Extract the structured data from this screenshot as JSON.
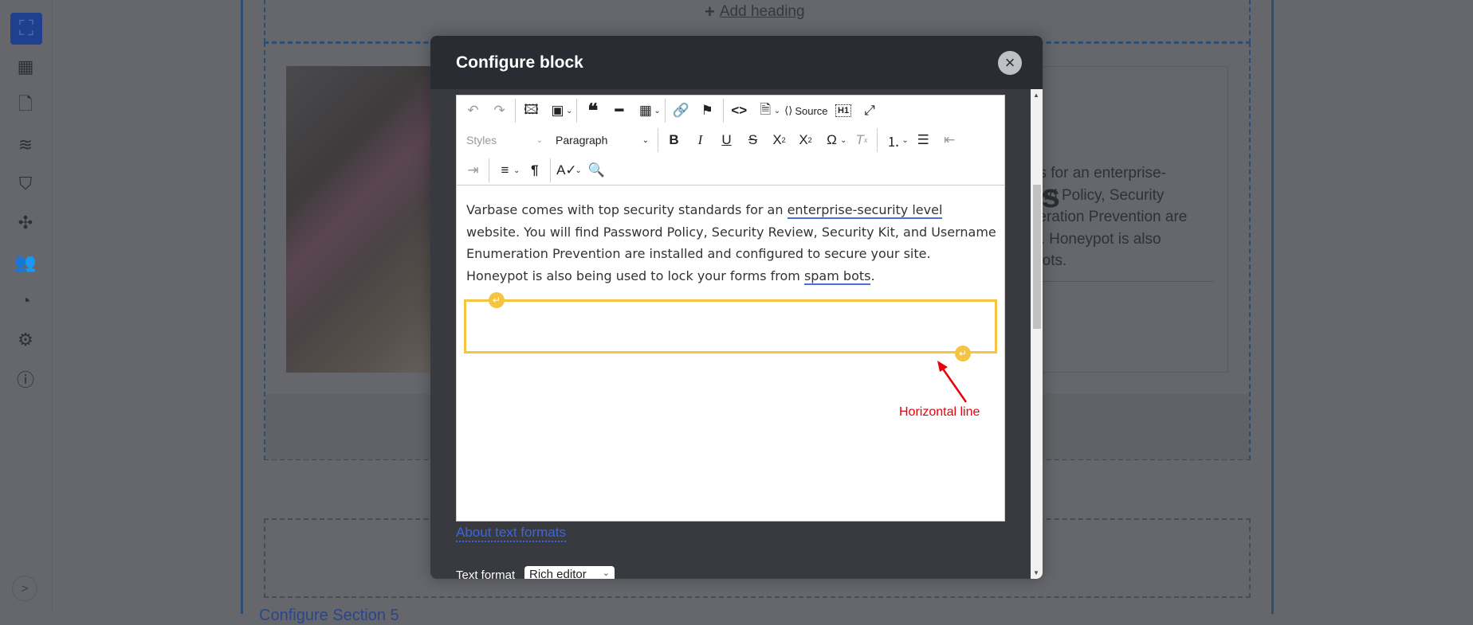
{
  "sidebar": {
    "icons": [
      "frame-icon",
      "dashboard-icon",
      "file-icon",
      "layers-icon",
      "paint-icon",
      "puzzle-icon",
      "users-icon",
      "pie-chart-icon",
      "gear-icon",
      "help-icon"
    ],
    "expand_label": ">"
  },
  "canvas": {
    "add_heading": "Add heading",
    "card_heading": "ds",
    "card_text": [
      "ards for an enterprise-",
      "sword Policy, Security",
      "umeration Prevention are",
      "site. Honeypot is also",
      "m bots."
    ],
    "bottom_link": "Configure Section 5"
  },
  "modal": {
    "title": "Configure block",
    "close_label": "×",
    "toolbar": {
      "source_label": "Source",
      "styles_label": "Styles",
      "paragraph_label": "Paragraph",
      "h1_label": "H1"
    },
    "content": {
      "p1": "Varbase comes with top security standards for an ",
      "link1": "enterprise-security level",
      "p2": " website. You will find Password Policy, Security Review, Security Kit, and Username Enumeration Prevention are installed and configured to secure your site. Honeypot is also being used to lock your forms from ",
      "link2": "spam bots",
      "p3": "."
    },
    "annotation": "Horizontal line",
    "about_link": "About text formats",
    "text_format_label": "Text format",
    "text_format_value": "Rich editor"
  },
  "colors": {
    "accent": "#f6c443",
    "annotation": "#e8000b",
    "link": "#3a66e0"
  }
}
